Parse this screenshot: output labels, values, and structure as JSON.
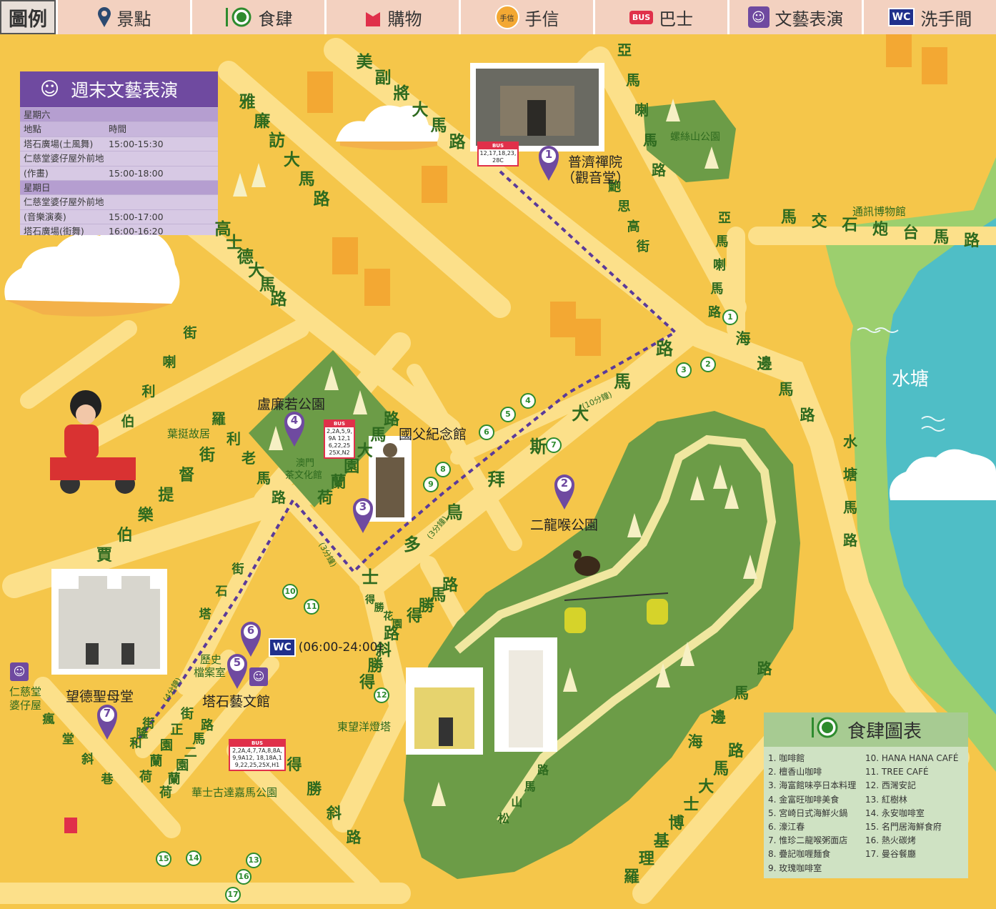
{
  "legend": {
    "title": "圖例",
    "items": [
      {
        "name": "scenic-spot",
        "label": "景點",
        "icon": "map-pin-icon"
      },
      {
        "name": "restaurants",
        "label": "食肆",
        "icon": "fork-plate-icon"
      },
      {
        "name": "shopping",
        "label": "購物",
        "icon": "shopping-bag-icon"
      },
      {
        "name": "souvenirs",
        "label": "手信",
        "icon": "souvenir-badge-icon",
        "badge": "手信"
      },
      {
        "name": "bus",
        "label": "巴士",
        "icon": "bus-icon",
        "badge": "BUS"
      },
      {
        "name": "performance",
        "label": "文藝表演",
        "icon": "theatre-masks-icon"
      },
      {
        "name": "restroom",
        "label": "洗手間",
        "icon": "wc-icon",
        "badge": "WC"
      }
    ]
  },
  "weekend_performance": {
    "title": "週末文藝表演",
    "saturday_label": "星期六",
    "col_location": "地點",
    "col_time": "時間",
    "saturday_rows": [
      {
        "location": "塔石廣場(土風舞)",
        "time": "15:00-15:30"
      },
      {
        "location": "仁慈堂婆仔屋外前地",
        "time": ""
      },
      {
        "location": "(作畫)",
        "time": "15:00-18:00"
      }
    ],
    "sunday_label": "星期日",
    "sunday_rows": [
      {
        "location": "仁慈堂婆仔屋外前地",
        "time": ""
      },
      {
        "location": "(音樂演奏)",
        "time": "15:00-17:00"
      },
      {
        "location": "塔石廣場(街舞)",
        "time": "16:00-16:20"
      }
    ]
  },
  "streets": [
    {
      "name": "street-mei-fu",
      "text": "美副將大馬路",
      "glyphs": [
        "美",
        "副",
        "將",
        "大",
        "馬",
        "路"
      ]
    },
    {
      "name": "street-ngai-lim",
      "text": "雅廉訪大馬路",
      "glyphs": [
        "雅",
        "廉",
        "訪",
        "大",
        "馬",
        "路"
      ]
    },
    {
      "name": "street-ko-si-tak",
      "text": "高士德大馬路",
      "glyphs": [
        "高",
        "士",
        "德",
        "大",
        "馬",
        "路"
      ]
    },
    {
      "name": "street-ah-mah",
      "text": "亞馬喇馬路",
      "glyphs": [
        "亞",
        "馬",
        "喇",
        "馬",
        "路"
      ]
    },
    {
      "name": "street-bao-si-ko",
      "text": "鮑思高街",
      "glyphs": [
        "鮑",
        "思",
        "高",
        "街"
      ]
    },
    {
      "name": "street-ma-kau-sek",
      "text": "馬交石炮台馬路",
      "glyphs": [
        "馬",
        "交",
        "石",
        "炮",
        "台",
        "馬",
        "路"
      ]
    },
    {
      "name": "street-ah-mah-2",
      "text": "亞馬喇馬路",
      "glyphs": [
        "亞",
        "馬",
        "喇",
        "馬",
        "路"
      ]
    },
    {
      "name": "street-hoi-pin",
      "text": "海邊馬路",
      "glyphs": [
        "海",
        "邊",
        "馬",
        "路"
      ]
    },
    {
      "name": "street-sui-tong",
      "text": "水塘馬路",
      "glyphs": [
        "水",
        "塘",
        "馬",
        "路"
      ]
    },
    {
      "name": "street-sidonio",
      "text": "士多鳥拜斯大馬路",
      "glyphs": [
        "士",
        "多",
        "鳥",
        "拜",
        "斯",
        "大",
        "馬",
        "路"
      ]
    },
    {
      "name": "street-holland",
      "text": "荷蘭園大馬路",
      "glyphs": [
        "荷",
        "蘭",
        "園",
        "大",
        "馬",
        "路"
      ]
    },
    {
      "name": "street-lou-lim-ieok",
      "text": "羅利老馬路",
      "glyphs": [
        "羅",
        "利",
        "老",
        "馬",
        "路"
      ]
    },
    {
      "name": "street-mou-lei",
      "text": "伯利喇街",
      "glyphs": [
        "伯",
        "利",
        "喇",
        "街"
      ]
    },
    {
      "name": "street-mellow",
      "text": "賈伯樂提督街",
      "glyphs": [
        "賈",
        "伯",
        "樂",
        "提",
        "督",
        "街"
      ]
    },
    {
      "name": "street-tap-seac",
      "text": "塔石街",
      "glyphs": [
        "塔",
        "石",
        "街"
      ]
    },
    {
      "name": "street-tak-seng-ma",
      "text": "得勝馬路",
      "glyphs": [
        "得",
        "勝",
        "馬",
        "路"
      ]
    },
    {
      "name": "street-tak-seng",
      "text": "得勝斜路",
      "glyphs": [
        "得",
        "勝",
        "斜",
        "路"
      ]
    },
    {
      "name": "street-tak-seng-2",
      "text": "得勝斜路",
      "glyphs": [
        "得",
        "勝",
        "斜",
        "路"
      ]
    },
    {
      "name": "street-holland-main",
      "text": "荷蘭園正街",
      "glyphs": [
        "荷",
        "蘭",
        "園",
        "正",
        "街"
      ]
    },
    {
      "name": "street-holland-2",
      "text": "荷蘭園二馬路",
      "glyphs": [
        "荷",
        "蘭",
        "園",
        "二",
        "馬",
        "路"
      ]
    },
    {
      "name": "street-wo-long",
      "text": "和隆街",
      "glyphs": [
        "和",
        "隆",
        "街"
      ]
    },
    {
      "name": "street-ma-tau",
      "text": "瘋堂斜巷",
      "glyphs": [
        "瘋",
        "堂",
        "斜",
        "巷"
      ]
    },
    {
      "name": "street-chung-shan",
      "text": "松山馬路",
      "glyphs": [
        "松",
        "山",
        "馬",
        "路"
      ]
    },
    {
      "name": "street-hoi-pin-2",
      "text": "海邊馬路",
      "glyphs": [
        "海",
        "邊",
        "馬",
        "路"
      ]
    },
    {
      "name": "street-rodrigo",
      "text": "羅理基博士大馬路",
      "glyphs": [
        "羅",
        "理",
        "基",
        "博",
        "士",
        "大",
        "馬",
        "路"
      ]
    },
    {
      "name": "street-tak-seng-garden",
      "text": "得勝花園",
      "glyphs": [
        "得",
        "勝",
        "花",
        "園"
      ]
    }
  ],
  "places": {
    "lotus_hill_park": "螺絲山公園",
    "comms_museum": "通訊博物館",
    "water_reservoir": "水塘",
    "kun_iam": "普濟禪院",
    "kun_iam_sub": "（觀音堂）",
    "lou_lim_ieok": "盧廉若公園",
    "tea_culture": "澳門茶文化館",
    "tea_line1": "澳門",
    "tea_line2": "茶文化館",
    "sun_yat_sen": "國父紀念館",
    "flora_garden": "二龍喉公園",
    "yip_ting": "葉挺故居",
    "archives": "歷史檔案室",
    "archives_line1": "歷史",
    "archives_line2": "檔案室",
    "tap_seac_gallery": "塔石藝文館",
    "st_lazarus": "望德聖母堂",
    "holy_house": "仁慈堂婆仔屋",
    "holy_house_line1": "仁慈堂",
    "holy_house_line2": "婆仔屋",
    "guia_lighthouse": "東望洋燈塔",
    "vasco_garden": "華士古達嘉馬公園",
    "wc_hours": "(06:00-24:00)",
    "walk_10": "(10分鐘)",
    "walk_3a": "(3分鐘)",
    "walk_3b": "(3分鐘)",
    "walk_4": "(4分鐘)"
  },
  "pins": [
    {
      "id": "1",
      "label": "1"
    },
    {
      "id": "2",
      "label": "2"
    },
    {
      "id": "3",
      "label": "3"
    },
    {
      "id": "4",
      "label": "4"
    },
    {
      "id": "5",
      "label": "5"
    },
    {
      "id": "6",
      "label": "6"
    },
    {
      "id": "7",
      "label": "7"
    }
  ],
  "food_markers": [
    "1",
    "2",
    "3",
    "4",
    "5",
    "6",
    "7",
    "8",
    "9",
    "10",
    "11",
    "12",
    "13",
    "14",
    "15",
    "16",
    "17"
  ],
  "bus_stops": [
    {
      "badge": "BUS",
      "routes": "12,17,18,23,28C"
    },
    {
      "badge": "BUS",
      "routes": "2,2A,5,9,9A 12,16,22,25 25X,N2"
    },
    {
      "badge": "BUS",
      "routes": "2,2A,4,7,7A,8,8A,9,9A12, 18,18A,19,22,25,25X,H1"
    }
  ],
  "food_panel": {
    "title": "食肆圖表",
    "left": [
      "1.  咖啡館",
      "2.  檀香山咖啡",
      "3.  海富館味亭日本料理",
      "4.  金富旺咖啡美食",
      "5.  宮崎日式海鮮火鍋",
      "6.  濠江春",
      "7.  惟珍二龍喉粥面店",
      "8.  疊記咖喱麵食",
      "9.  玫瑰咖啡室"
    ],
    "right": [
      "10. HANA HANA CAFÉ",
      "11. TREE CAFÉ",
      "12. 西灣安記",
      "13. 紅樹林",
      "14. 永安咖啡室",
      "15. 名門居海鮮食府",
      "16. 熱火碳烤",
      "17. 曼谷餐廳"
    ]
  },
  "colors": {
    "road": "#fce08a",
    "block": "#f5c64a",
    "park": "#6c9c47",
    "park_light": "#a7cb92",
    "water": "#4fbec6",
    "pin": "#6f4aa0",
    "food": "#2e8b2e",
    "route": "#5a3a9a"
  }
}
